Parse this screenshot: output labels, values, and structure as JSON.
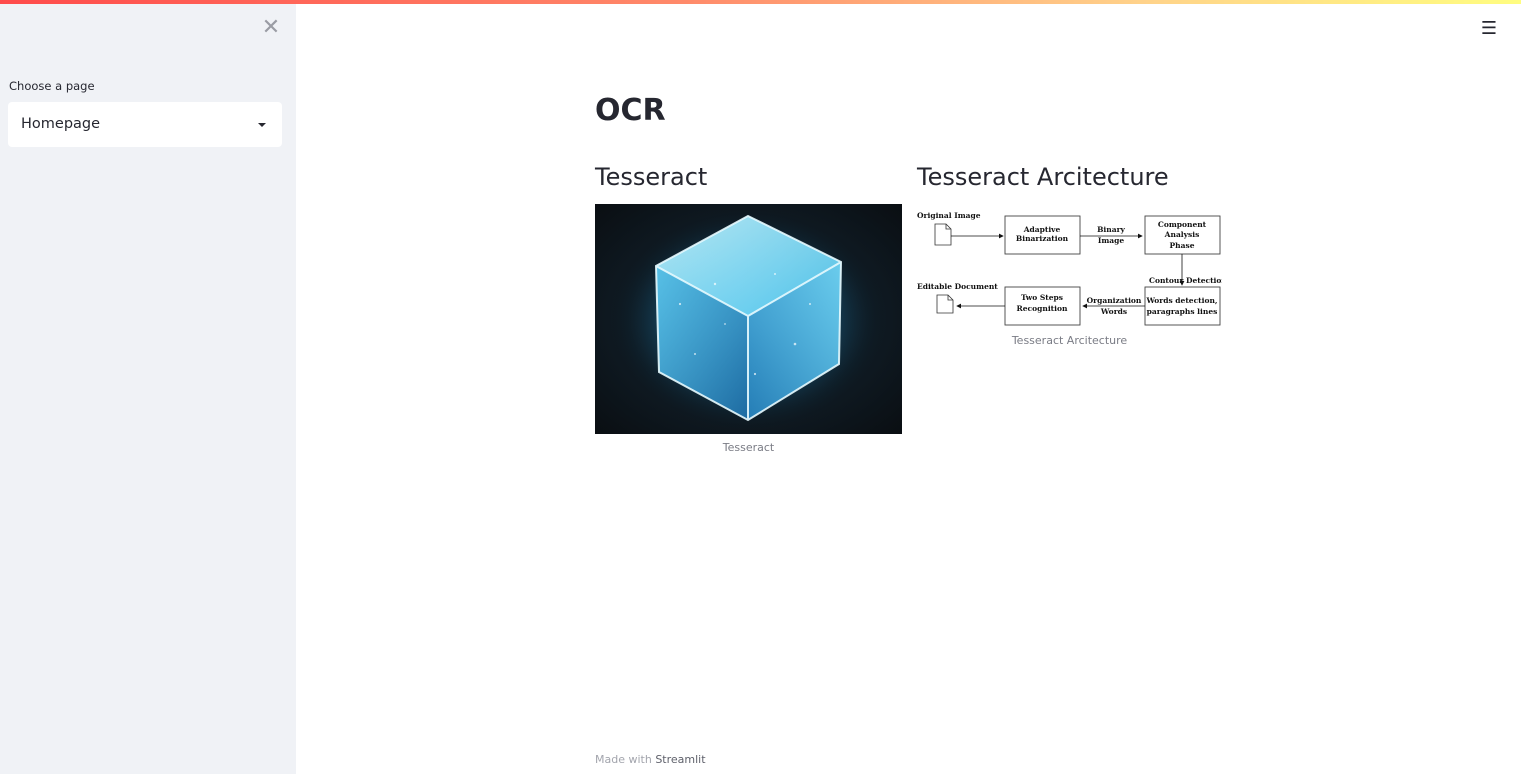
{
  "app": {
    "accent_color": "#ff4b4b",
    "sidebar_bg": "#f0f2f6"
  },
  "sidebar": {
    "close_icon": "close-icon",
    "select_label": "Choose a page",
    "select_value": "Homepage"
  },
  "header": {
    "menu_icon": "hamburger-menu-icon"
  },
  "main": {
    "title": "OCR",
    "col1": {
      "heading": "Tesseract",
      "image_caption": "Tesseract"
    },
    "col2": {
      "heading": "Tesseract Arcitecture",
      "image_caption": "Tesseract Arcitecture",
      "diagram": {
        "original_image": "Original Image",
        "adaptive_1": "Adaptive",
        "adaptive_2": "Binarization",
        "binary_1": "Binary",
        "binary_2": "Image",
        "component_1": "Component",
        "component_2": "Analysis",
        "component_3": "Phase",
        "contour": "Contour",
        "detection": "Detection",
        "words_1": "Words detection,",
        "words_2": "paragraphs lines",
        "org_1": "Organization",
        "org_2": "Words",
        "two_steps_1": "Two Steps",
        "two_steps_2": "Recognition",
        "editable": "Editable Document"
      }
    }
  },
  "footer": {
    "prefix": "Made with ",
    "brand": "Streamlit"
  }
}
